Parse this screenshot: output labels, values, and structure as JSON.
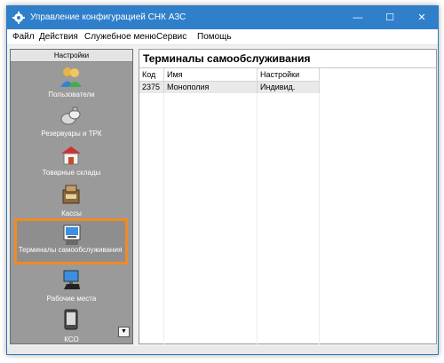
{
  "window": {
    "title": "Управление конфигурацией СНК АЗС"
  },
  "window_controls": {
    "minimize": "—",
    "maximize": "☐",
    "close": "✕"
  },
  "menu": [
    "Файл",
    "Действия",
    "Служебное меню",
    "Сервис",
    "Помощь"
  ],
  "sidebar": {
    "header": "Настройки",
    "items": [
      {
        "label": "Пользователи",
        "icon": "users-icon"
      },
      {
        "label": "Резервуары и ТРК",
        "icon": "tanks-icon"
      },
      {
        "label": "Товарные склады",
        "icon": "warehouse-icon"
      },
      {
        "label": "Кассы",
        "icon": "cash-register-icon"
      },
      {
        "label": "Терминалы самообслуживания",
        "icon": "self-service-terminal-icon",
        "selected": true
      },
      {
        "label": "Рабочие места",
        "icon": "workstation-icon"
      },
      {
        "label": "КСО",
        "icon": "kso-icon"
      }
    ],
    "scroll_glyph": "▼"
  },
  "main": {
    "title": "Терминалы самообслуживания",
    "columns": [
      "Код",
      "Имя",
      "Настройки"
    ],
    "rows": [
      {
        "code": "2375",
        "name": "Монополия",
        "settings": "Индивид."
      }
    ]
  },
  "colors": {
    "titlebar": "#2f7fcb",
    "sidebar": "#9a9a9a",
    "highlight": "#f08a24"
  }
}
